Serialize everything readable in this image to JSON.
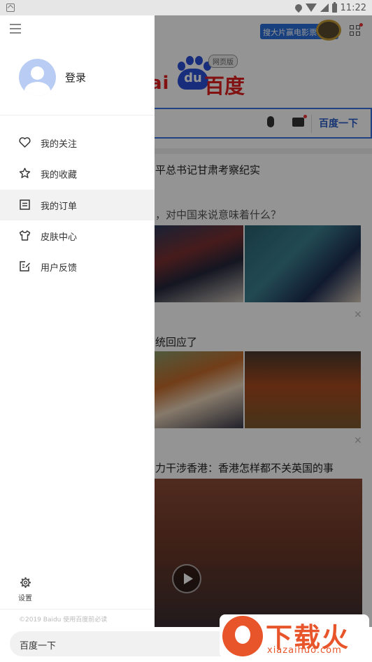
{
  "status_bar": {
    "time": "11:22"
  },
  "page": {
    "promo_label": "搜大片赢电影票",
    "logo": {
      "latin": "ai",
      "paw_text": "du",
      "chinese": "百度",
      "tag": "网页版"
    },
    "search_button": "百度一下",
    "headlines": [
      "平总书记甘肃考察纪实",
      "，对中国来说意味着什么？",
      "统回应了",
      "力干涉香港：香港怎样都不关英国的事"
    ],
    "close_glyph": "✕"
  },
  "drawer": {
    "login_label": "登录",
    "menu_items": [
      {
        "icon": "heart-icon",
        "label": "我的关注"
      },
      {
        "icon": "star-icon",
        "label": "我的收藏"
      },
      {
        "icon": "order-list-icon",
        "label": "我的订单"
      },
      {
        "icon": "shirt-icon",
        "label": "皮肤中心"
      },
      {
        "icon": "feedback-edit-icon",
        "label": "用户反馈"
      }
    ],
    "settings_label": "设置",
    "legal_text": "©2019 Baidu 使用百度前必读"
  },
  "bottom_search": {
    "placeholder": "百度一下"
  },
  "watermark": {
    "title": "下载火",
    "url": "xiazaihuo.com"
  },
  "colors": {
    "accent_blue": "#3a72dc",
    "brand_red": "#e02020",
    "watermark_orange": "#e8552a"
  }
}
